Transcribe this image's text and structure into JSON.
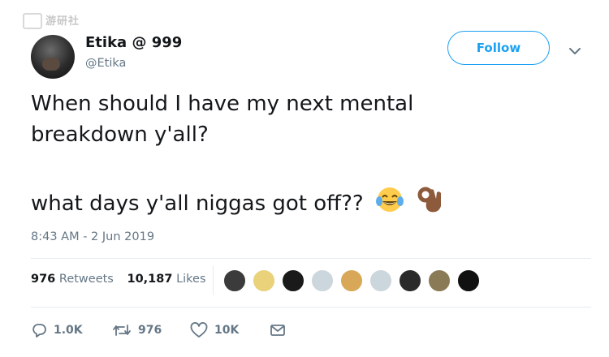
{
  "user": {
    "display_name": "Etika @ 999",
    "handle": "@Etika",
    "avatar_icon": "avatar-photo"
  },
  "header": {
    "follow_label": "Follow",
    "more_icon": "chevron-down-icon"
  },
  "tweet": {
    "text_part1": "When should I have my next mental\nbreakdown y'all?",
    "text_part2": "what days y'all niggas got off??",
    "emojis": [
      "face-with-tears-of-joy",
      "ok-hand-medium-dark-skin"
    ],
    "timestamp": "8:43 AM - 2 Jun 2019"
  },
  "stats": {
    "retweets_count": "976",
    "retweets_label": "Retweets",
    "likes_count": "10,187",
    "likes_label": "Likes"
  },
  "actions": {
    "reply_count": "1.0K",
    "retweet_count": "976",
    "like_count": "10K"
  },
  "watermark": {
    "text": "游研社"
  },
  "colors": {
    "accent": "#1da1f2",
    "secondary_text": "#657786",
    "primary_text": "#14171a",
    "divider": "#e6ecf0"
  }
}
